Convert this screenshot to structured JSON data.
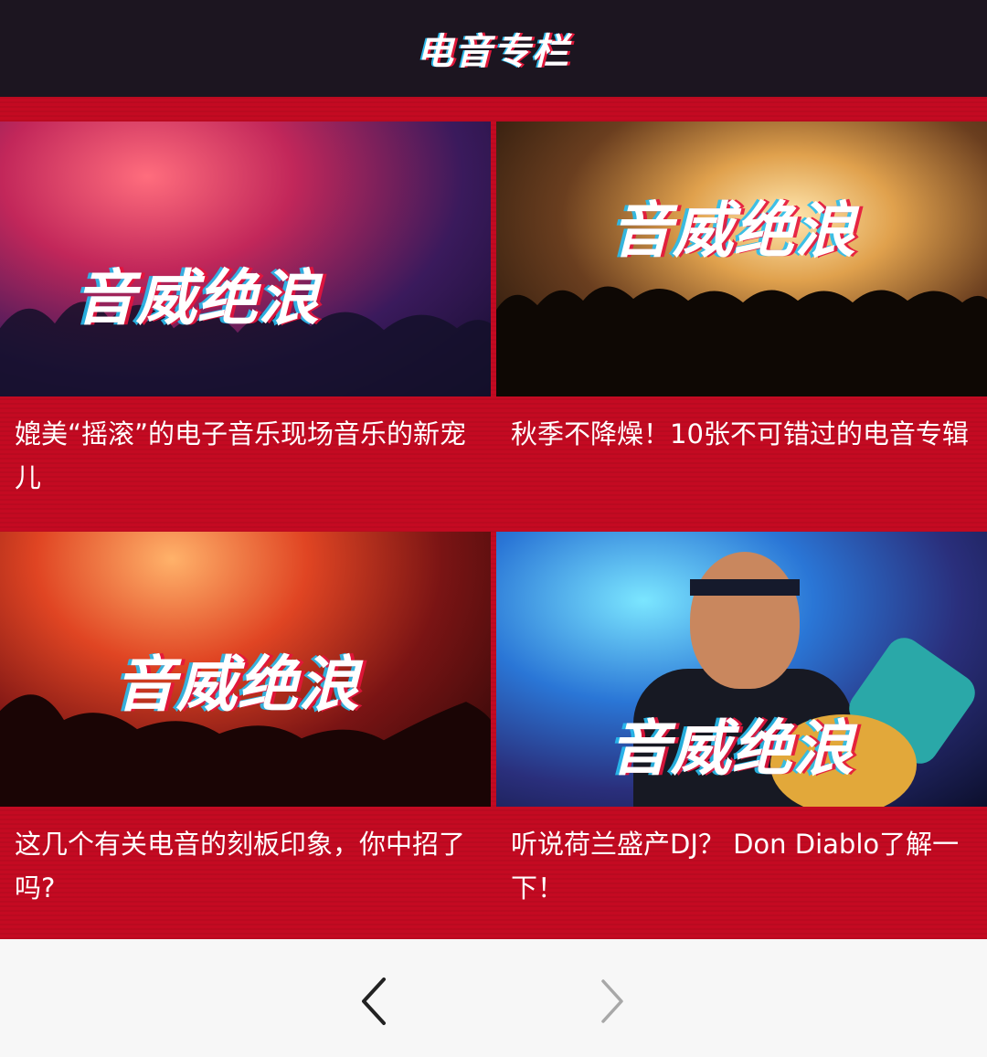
{
  "header": {
    "title": "电音专栏"
  },
  "cards": [
    {
      "caption": "媲美“摇滚”的电子音乐现场音乐的新宠儿",
      "logo_text": "音威绝浪"
    },
    {
      "caption": "秋季不降燥！10张不可错过的电音专辑",
      "logo_text": "音威绝浪"
    },
    {
      "caption": "这几个有关电音的刻板印象，你中招了吗?",
      "logo_text": "音威绝浪"
    },
    {
      "caption": "听说荷兰盛产DJ？ Don Diablo了解一下！",
      "logo_text": "音威绝浪"
    }
  ],
  "nav": {
    "prev_icon": "chevron-left-icon",
    "next_icon": "chevron-right-icon"
  },
  "colors": {
    "header_bg": "#1c1520",
    "grid_bg": "#c40a22",
    "nav_bg": "#f7f7f7"
  }
}
